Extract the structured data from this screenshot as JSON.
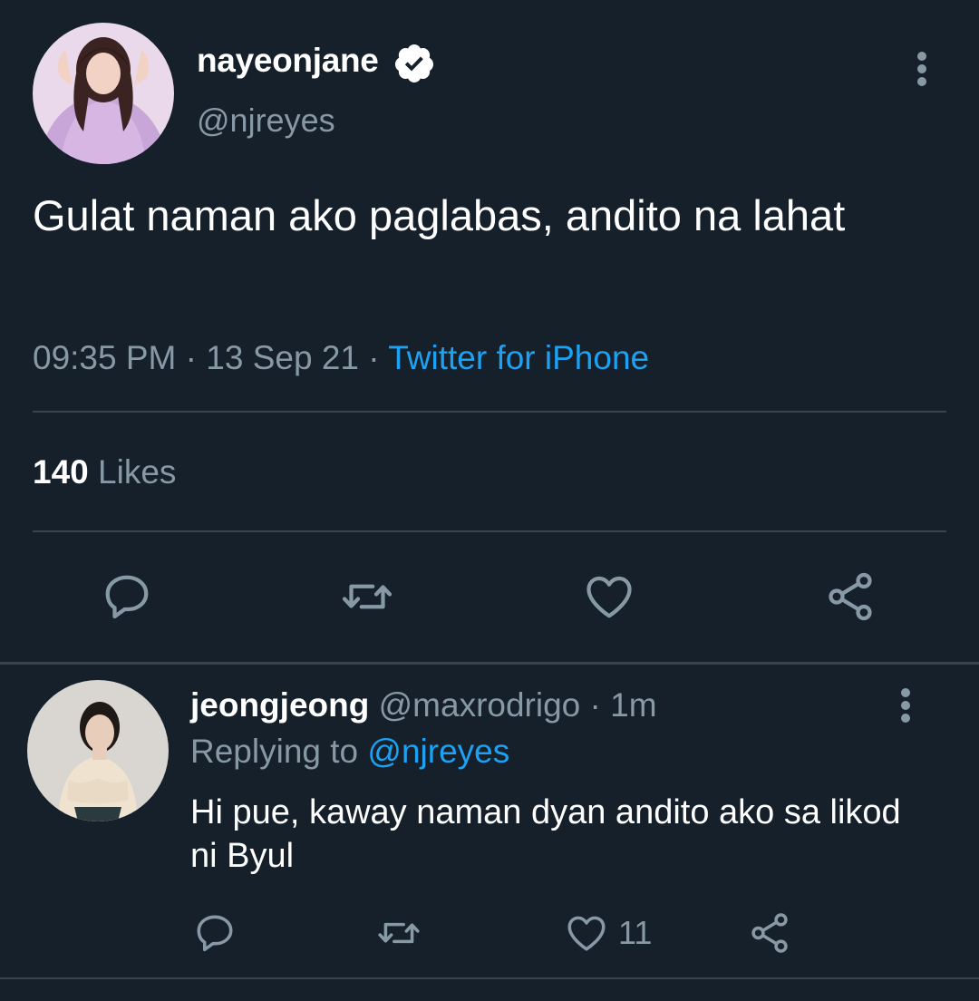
{
  "tweet": {
    "author_name": "nayeonjane",
    "author_handle": "@njreyes",
    "verified": true,
    "text": "Gulat naman ako paglabas, andito na lahat",
    "time": "09:35 PM",
    "date": "13 Sep 21",
    "source": "Twitter for iPhone",
    "likes_count": "140",
    "likes_label": "Likes"
  },
  "reply": {
    "author_name": "jeongjeong",
    "author_handle": "@maxrodrigo",
    "age": "1m",
    "replying_prefix": "Replying to",
    "replying_to": "@njreyes",
    "text": "Hi pue, kaway naman dyan andito ako sa likod ni Byul",
    "like_count": "11"
  },
  "icons": {
    "verified": "verified-badge-icon",
    "more": "more-vertical-icon",
    "reply": "reply-icon",
    "retweet": "retweet-icon",
    "like": "heart-icon",
    "share": "share-icon"
  },
  "colors": {
    "background": "#15202b",
    "text_primary": "#ffffff",
    "text_secondary": "#8899a6",
    "accent": "#1da1f2",
    "divider": "#38444d"
  }
}
